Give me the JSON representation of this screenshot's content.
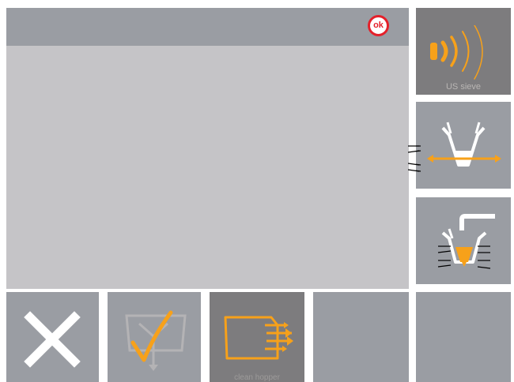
{
  "header": {
    "ok_label": "ok"
  },
  "side_buttons": {
    "us_sieve": {
      "label": "US sieve",
      "icon": "ultrasound-waves-icon"
    },
    "spread": {
      "icon": "hopper-spread-icon"
    },
    "vibrate": {
      "icon": "hopper-vibrate-icon"
    }
  },
  "bottom_buttons": {
    "cancel": {
      "icon": "x-cancel-icon"
    },
    "confirm": {
      "icon": "hopper-check-icon"
    },
    "clean_hopper": {
      "label": "clean hopper",
      "icon": "hopper-clean-icon"
    }
  },
  "colors": {
    "accent": "#f7a11a",
    "panel": "#9a9da3",
    "panel_dark": "#7d7c7e",
    "content": "#c5c4c7",
    "ok_red": "#e4202a"
  }
}
